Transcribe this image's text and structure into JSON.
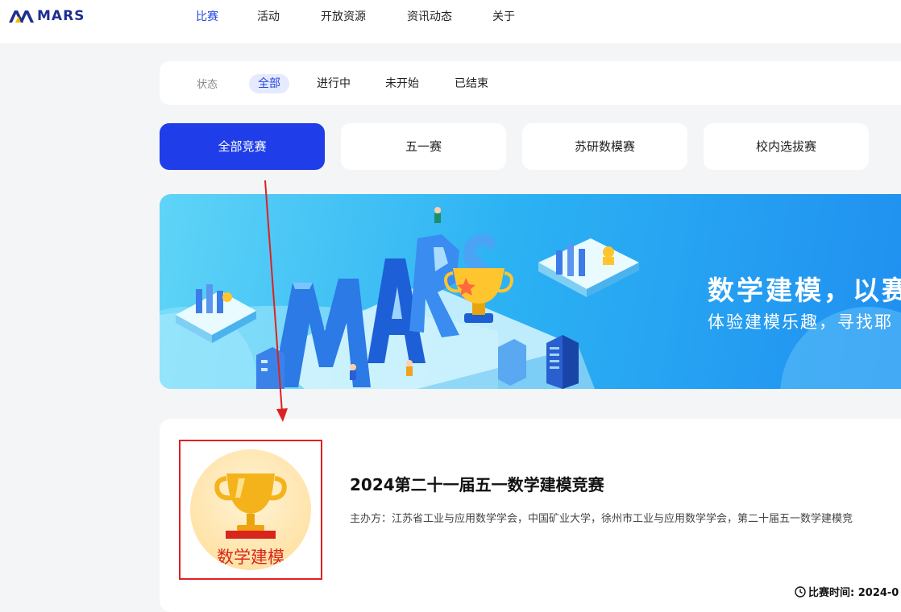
{
  "brand": {
    "name": "MARS",
    "color": "#1f2f8f"
  },
  "nav": {
    "items": [
      {
        "label": "比赛",
        "active": true
      },
      {
        "label": "活动"
      },
      {
        "label": "开放资源"
      },
      {
        "label": "资讯动态"
      },
      {
        "label": "关于"
      }
    ]
  },
  "status_filter": {
    "label": "状态",
    "options": [
      {
        "label": "全部",
        "active": true
      },
      {
        "label": "进行中"
      },
      {
        "label": "未开始"
      },
      {
        "label": "已结束"
      }
    ]
  },
  "categories": [
    {
      "label": "全部竞赛",
      "active": true
    },
    {
      "label": "五一赛"
    },
    {
      "label": "苏研数模赛"
    },
    {
      "label": "校内选拔赛"
    }
  ],
  "banner": {
    "title": "数学建模，以赛",
    "subtitle": "体验建模乐趣，寻找耶",
    "illustration_text": "MARS"
  },
  "competition": {
    "thumb_text": "数学建模",
    "title": "2024第二十一届五一数学建模竞赛",
    "host": "主办方：江苏省工业与应用数学学会，中国矿业大学，徐州市工业与应用数学学会，第二十届五一数学建模竞",
    "time": "比赛时间: 2024-0"
  },
  "colors": {
    "accent": "#2447e0",
    "active_tab": "#1f3de8",
    "annotation": "#e02020"
  }
}
